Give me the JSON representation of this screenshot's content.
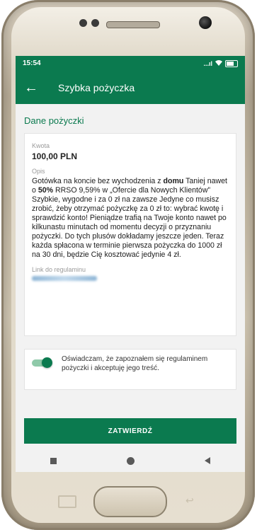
{
  "status_bar": {
    "time": "15:54",
    "signal": "...ıl"
  },
  "app_bar": {
    "title": "Szybka pożyczka"
  },
  "section": {
    "title": "Dane pożyczki"
  },
  "loan": {
    "amount_label": "Kwota",
    "amount_value": "100,00 PLN",
    "description_label": "Opis",
    "description_parts": {
      "p1": "Gotówka na koncie bez wychodzenia z ",
      "p1_bold": "domu",
      "p2": " Taniej nawet o ",
      "p2_bold": "50%",
      "p3": " RRSO 9,59% w „Ofercie dla Nowych Klientów” Szybkie, wygodne i za 0 zł na zawsze Jedyne co musisz zrobić, żeby otrzymać pożyczkę za 0 zł to: wybrać kwotę i sprawdzić konto! Pieniądze trafią na Twoje konto nawet po kilkunastu minutach od momentu decyzji o przyznaniu pożyczki. Do tych plusów dokładamy jeszcze jeden. Teraz każda spłacona w terminie pierwsza pożyczka do 1000 zł na 30 dni, będzie Cię kosztować jedynie 4 zł."
    },
    "link_label": "Link do regulaminu"
  },
  "consent": {
    "text": "Oświadczam, że zapoznałem się regulaminem pożyczki i akceptuję jego treść.",
    "checked": true
  },
  "button": {
    "confirm_label": "ZATWIERDŹ"
  },
  "colors": {
    "brand": "#0b7a4f",
    "toggle_track": "#8fc9a9",
    "background": "#f2f2f2"
  },
  "icons": [
    "back-arrow-icon",
    "wifi-icon",
    "battery-icon",
    "nav-recent-icon",
    "nav-home-icon",
    "nav-back-icon"
  ]
}
